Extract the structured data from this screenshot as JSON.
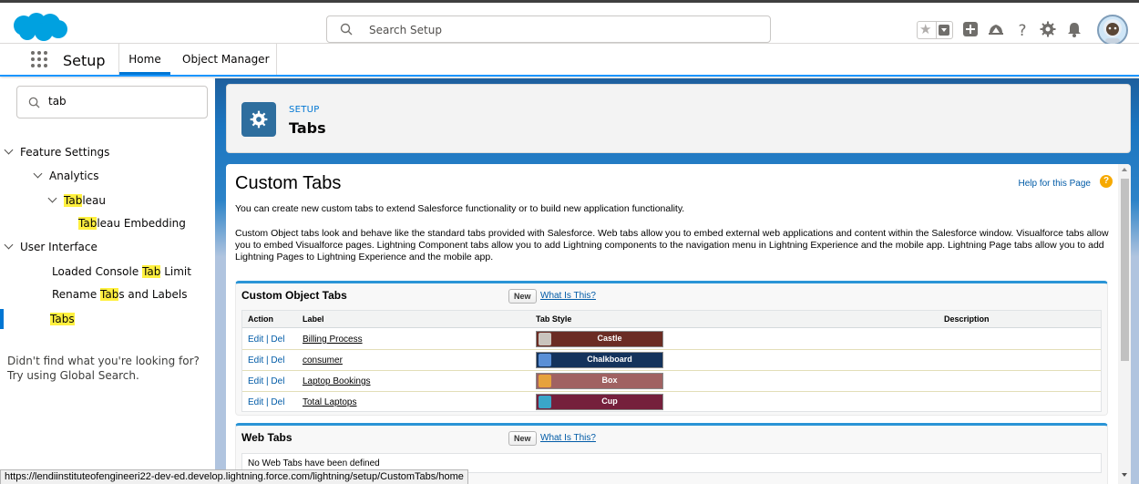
{
  "header": {
    "search_placeholder": "Search Setup",
    "colors": {
      "brand": "#00a1e0",
      "border": "#dddbda"
    },
    "icons": [
      "favorites-star-icon",
      "favorites-dropdown-icon",
      "global-actions-icon",
      "trailhead-guidance-icon",
      "help-icon",
      "setup-gear-icon",
      "notifications-bell-icon"
    ]
  },
  "appnav": {
    "app_name": "Setup",
    "tabs": [
      {
        "label": "Home",
        "active": true
      },
      {
        "label": "Object Manager",
        "active": false
      }
    ]
  },
  "sidebar": {
    "quick_find_value": "tab",
    "tree": [
      {
        "label": "Feature Settings",
        "level": 0,
        "expanded": true
      },
      {
        "label": "Analytics",
        "level": 1,
        "expanded": true
      },
      {
        "label_pre": "",
        "label_hl": "Tab",
        "label_post": "leau",
        "level": 2,
        "expanded": true
      },
      {
        "label_pre": "",
        "label_hl": "Tab",
        "label_post": "leau Embedding",
        "level": 3
      },
      {
        "label": "User Interface",
        "level": 0,
        "expanded": true
      },
      {
        "label_pre": "Loaded Console ",
        "label_hl": "Tab",
        "label_post": " Limit",
        "level": 2
      },
      {
        "label_pre": "Rename ",
        "label_hl": "Tab",
        "label_post": "s and Labels",
        "level": 2
      },
      {
        "label_pre": "",
        "label_hl": "Tabs",
        "label_post": "",
        "level": 2,
        "selected": true
      }
    ],
    "not_found_line1": "Didn't find what you're looking for?",
    "not_found_line2": "Try using Global Search."
  },
  "page_header": {
    "breadcrumb": "SETUP",
    "title": "Tabs",
    "icon": "gear-icon"
  },
  "content": {
    "title": "Custom Tabs",
    "help_link": "Help for this Page",
    "intro": "You can create new custom tabs to extend Salesforce functionality or to build new application functionality.",
    "details": "Custom Object tabs look and behave like the standard tabs provided with Salesforce. Web tabs allow you to embed external web applications and content within the Salesforce window. Visualforce tabs allow you to embed Visualforce pages. Lightning Component tabs allow you to add Lightning components to the navigation menu in Lightning Experience and the mobile app. Lightning Page tabs allow you to add Lightning Pages to Lightning Experience and the mobile app.",
    "custom_object_tabs": {
      "heading": "Custom Object Tabs",
      "new_label": "New",
      "what_is_this": "What Is This?",
      "columns": [
        "Action",
        "Label",
        "Tab Style",
        "Description"
      ],
      "rows": [
        {
          "edit": "Edit",
          "del": "Del",
          "label": "Billing Process",
          "style_name": "Castle",
          "style_color": "#6b2c24",
          "icon_color": "#c9c4bd",
          "description": ""
        },
        {
          "edit": "Edit",
          "del": "Del",
          "label": "consumer",
          "style_name": "Chalkboard",
          "style_color": "#14335c",
          "icon_color": "#5a8fd6",
          "description": ""
        },
        {
          "edit": "Edit",
          "del": "Del",
          "label": "Laptop Bookings",
          "style_name": "Box",
          "style_color": "#a06262",
          "icon_color": "#e6a23c",
          "description": ""
        },
        {
          "edit": "Edit",
          "del": "Del",
          "label": "Total Laptops",
          "style_name": "Cup",
          "style_color": "#75203c",
          "icon_color": "#3aa6c9",
          "description": ""
        }
      ],
      "separator": "|"
    },
    "web_tabs": {
      "heading": "Web Tabs",
      "new_label": "New",
      "what_is_this": "What Is This?",
      "empty_text": "No Web Tabs have been defined"
    }
  },
  "status_url": "https://lendiinstituteofengineeri22-dev-ed.develop.lightning.force.com/lightning/setup/CustomTabs/home"
}
